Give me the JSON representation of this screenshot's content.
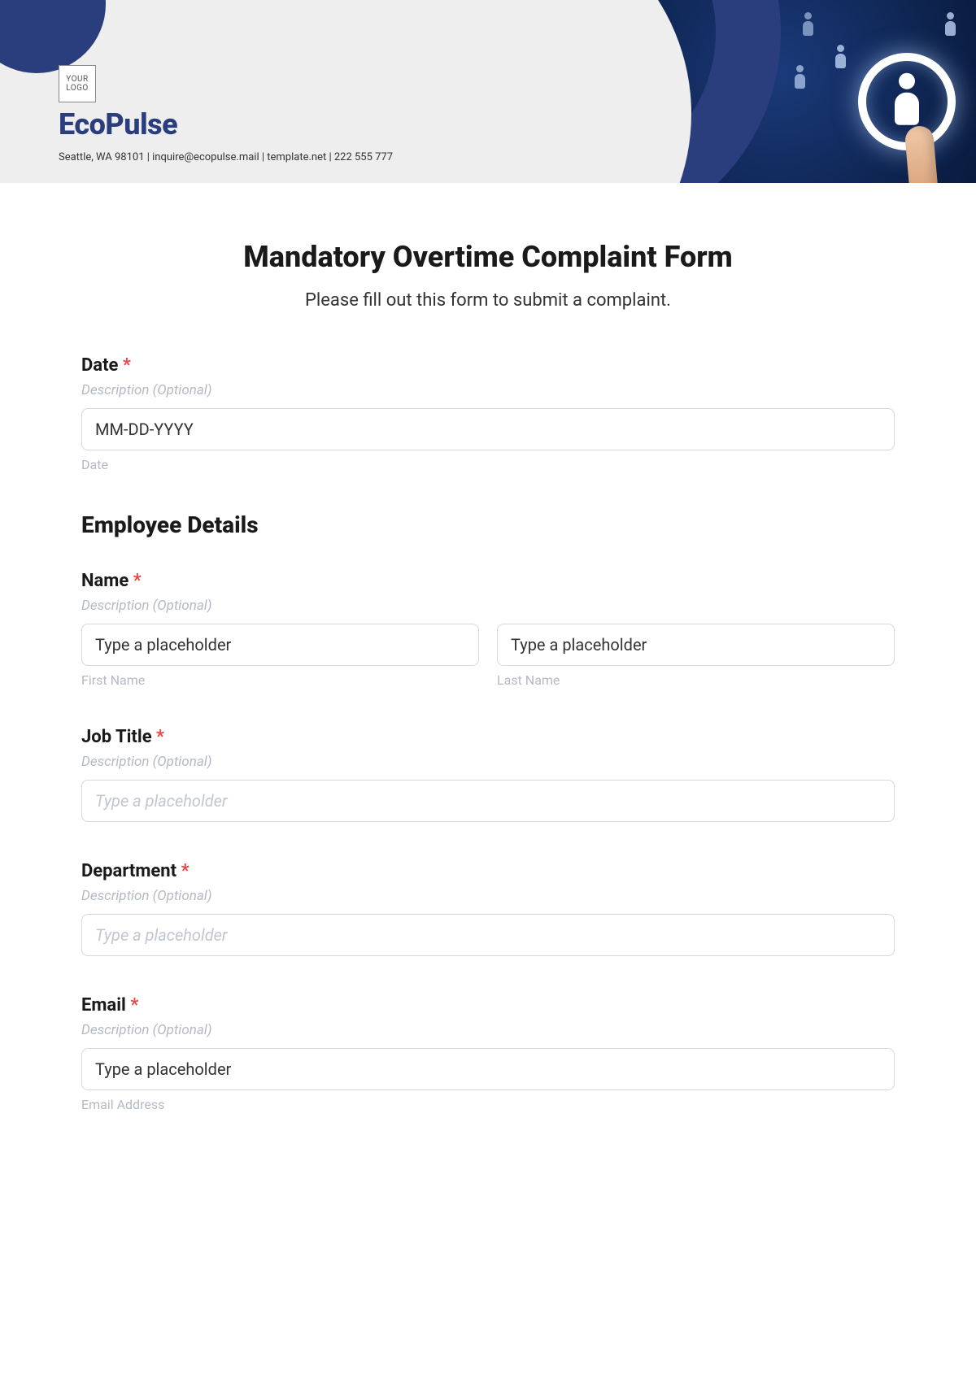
{
  "header": {
    "logo_placeholder": "YOUR\nLOGO",
    "brand": "EcoPulse",
    "subline": "Seattle, WA 98101 | inquire@ecopulse.mail | template.net | 222 555 777"
  },
  "form": {
    "title": "Mandatory Overtime Complaint Form",
    "subtitle": "Please fill out this form to submit a complaint.",
    "required_mark": "*",
    "desc_optional": "Description (Optional)",
    "fields": {
      "date": {
        "label": "Date",
        "placeholder": "MM-DD-YYYY",
        "help": "Date"
      },
      "section_employee": "Employee Details",
      "name": {
        "label": "Name",
        "first_placeholder": "Type a placeholder",
        "first_help": "First Name",
        "last_placeholder": "Type a placeholder",
        "last_help": "Last Name"
      },
      "job_title": {
        "label": "Job Title",
        "placeholder": "Type a placeholder"
      },
      "department": {
        "label": "Department",
        "placeholder": "Type a placeholder"
      },
      "email": {
        "label": "Email",
        "placeholder": "Type a placeholder",
        "help": "Email Address"
      }
    }
  }
}
